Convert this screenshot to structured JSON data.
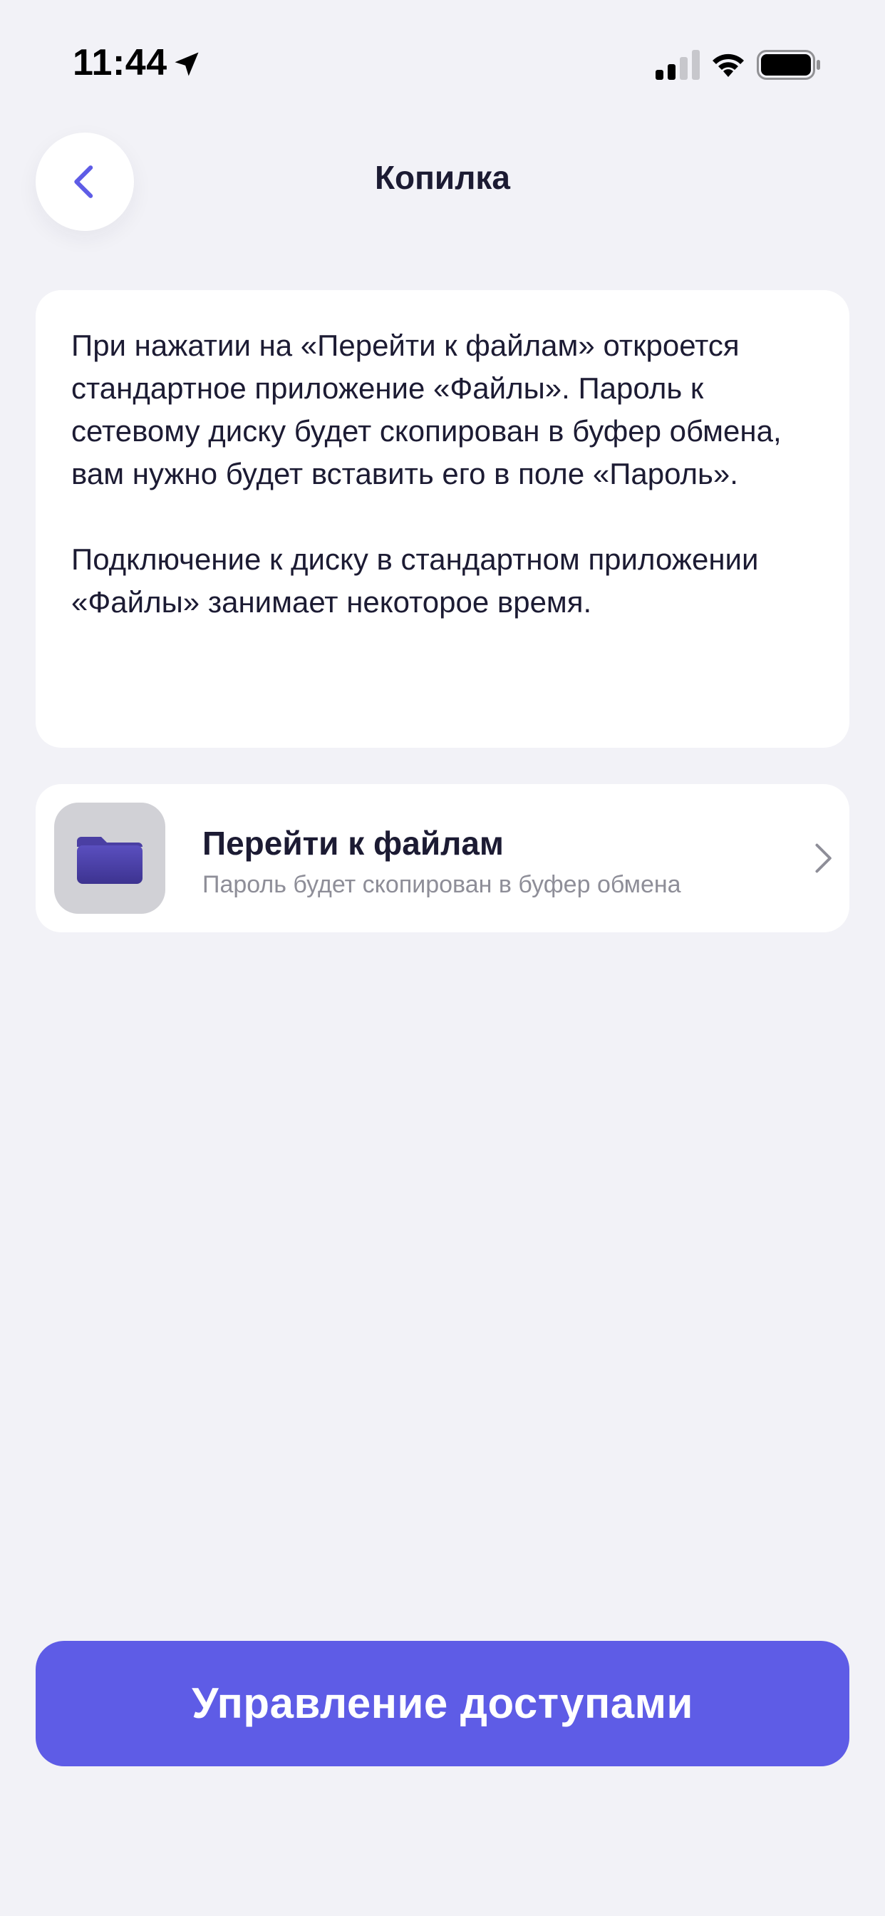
{
  "status_bar": {
    "time": "11:44",
    "icons": [
      "location-arrow-icon",
      "cellular-signal-icon",
      "wifi-icon",
      "battery-icon"
    ]
  },
  "nav": {
    "back_icon": "chevron-left-icon",
    "title": "Копилка"
  },
  "info_card": {
    "paragraphs": [
      "При нажатии на «Перейти к файлам» откроется стандартное приложение «Файлы». Пароль к сетевому диску будет скопирован в буфер обмена, вам нужно будет вставить его в поле «Пароль».",
      "Подключение к диску в стандартном приложении «Файлы» занимает некоторое время."
    ]
  },
  "files_row": {
    "icon": "folder-icon",
    "title": "Перейти к файлам",
    "subtitle": "Пароль будет скопирован в буфер обмена",
    "chevron": "chevron-right-icon"
  },
  "bottom_button": {
    "label": "Управление доступами"
  },
  "colors": {
    "background": "#F2F2F7",
    "card": "#FFFFFF",
    "accent": "#5E5CE6",
    "text_primary": "#1C1B33",
    "text_secondary": "#8E8E98",
    "app_icon_bg": "#D1D1D6",
    "folder": "#4B3FA6"
  }
}
